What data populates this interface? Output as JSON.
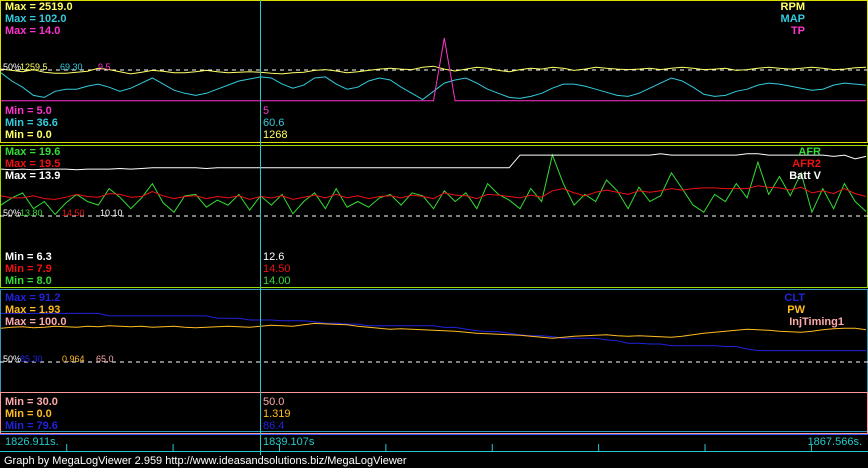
{
  "app": {
    "footer": "Graph by MegaLogViewer 2.959 http://www.ideasandsolutions.biz/MegaLogViewer"
  },
  "colors": {
    "rpm": "#FFFF66",
    "map": "#33CCDD",
    "tp": "#FF33CC",
    "afr": "#33DD33",
    "afr2": "#EE1111",
    "batt": "#FFFFFF",
    "clt": "#2222DD",
    "pw": "#FFBB22",
    "injtiming": "#FFAAAA",
    "cursor": "#22CCCC",
    "panel1_border": "#DDDD00",
    "panel2_border": "#99DD00",
    "panel3_border": "#3399BB",
    "panel4_border": "#FF9999"
  },
  "timeline": {
    "start": "1826.911s.",
    "cursor": "1839.107s",
    "end": "1867.566s."
  },
  "chart_data": [
    {
      "type": "line",
      "panel": "panel1",
      "x_range": [
        1826.911,
        1867.566
      ],
      "cursor_x": 1839.107,
      "series": [
        {
          "name": "RPM",
          "color_key": "rpm",
          "max_label": "Max = 2519.0",
          "min_label": "Min = 0.0",
          "cursor_value": "1268",
          "mid_value": "1259.5",
          "ylim": [
            0,
            2519
          ],
          "values": [
            1350,
            1300,
            1250,
            1330,
            1230,
            1190,
            1190,
            1230,
            1270,
            1380,
            1330,
            1250,
            1170,
            1230,
            1300,
            1270,
            1210,
            1210,
            1250,
            1300,
            1250,
            1210,
            1230,
            1250,
            1230,
            1190,
            1170,
            1210,
            1230,
            1300,
            1330,
            1280,
            1210,
            1250,
            1300,
            1350,
            1380,
            1350,
            1330,
            1420,
            1460,
            1350,
            1280,
            1350,
            1420,
            1380,
            1300,
            1250,
            1330,
            1380,
            1350,
            1420,
            1380,
            1300,
            1350,
            1420,
            1380,
            1350,
            1330,
            1350,
            1380,
            1330,
            1380,
            1420,
            1380,
            1330,
            1350,
            1380,
            1300,
            1330,
            1380,
            1420,
            1380,
            1350,
            1380,
            1420,
            1380,
            1330,
            1350,
            1400,
            1420
          ]
        },
        {
          "name": "MAP",
          "color_key": "map",
          "max_label": "Max = 102.0",
          "min_label": "Min = 36.6",
          "cursor_value": "60.6",
          "mid_value": "69.30",
          "ylim": [
            36.6,
            102.0
          ],
          "values": [
            68,
            60,
            54,
            46,
            44,
            50,
            52,
            52,
            55,
            57,
            54,
            50,
            53,
            58,
            63,
            57,
            51,
            48,
            46,
            48,
            52,
            56,
            60,
            62,
            64,
            63,
            57,
            53,
            56,
            63,
            64,
            57,
            52,
            54,
            60,
            63,
            61,
            54,
            48,
            42,
            50,
            58,
            61,
            63,
            58,
            52,
            48,
            44,
            43,
            45,
            48,
            53,
            57,
            57,
            55,
            52,
            49,
            46,
            45,
            48,
            53,
            58,
            63,
            60,
            54,
            47,
            45,
            46,
            50,
            52,
            56,
            58,
            57,
            55,
            53,
            51,
            52,
            56,
            58,
            57,
            56
          ]
        },
        {
          "name": "TP",
          "color_key": "tp",
          "max_label": "Max = 14.0",
          "min_label": "Min = 5.0",
          "cursor_value": "5",
          "mid_value": "9.5",
          "ylim": [
            4.4,
            14
          ],
          "values": [
            5,
            5,
            5,
            5,
            5,
            5,
            5,
            5,
            5,
            5,
            5,
            5,
            5,
            5,
            5,
            5,
            5,
            5,
            5,
            5,
            5,
            5,
            5,
            5,
            5,
            5,
            5,
            5,
            5,
            5,
            5,
            5,
            5,
            5,
            5,
            5,
            5,
            5,
            5,
            5,
            5,
            14,
            5,
            5,
            5,
            5,
            5,
            5,
            5,
            5,
            5,
            5,
            5,
            5,
            5,
            5,
            5,
            5,
            5,
            5,
            5,
            5,
            5,
            5,
            5,
            5,
            5,
            5,
            5,
            5,
            5,
            5,
            5,
            5,
            5,
            5,
            5,
            5,
            5,
            5,
            5
          ]
        }
      ]
    },
    {
      "type": "line",
      "panel": "panel2",
      "x_range": [
        1826.911,
        1867.566
      ],
      "cursor_x": 1839.107,
      "series": [
        {
          "name": "AFR",
          "color_key": "afr",
          "max_label": "Max = 19.6",
          "min_label": "Min = 8.0",
          "cursor_value": "14.00",
          "mid_value": "13.80",
          "ylim": [
            6.5,
            20.2
          ],
          "values": [
            12.5,
            13.5,
            14.2,
            12.0,
            13.0,
            11.2,
            12.8,
            14.0,
            13.0,
            12.5,
            14.8,
            13.6,
            12.0,
            13.5,
            15.5,
            12.8,
            11.5,
            13.8,
            14.0,
            12.2,
            13.2,
            12.5,
            14.0,
            11.8,
            13.8,
            12.5,
            14.0,
            11.3,
            13.0,
            14.2,
            12.0,
            14.8,
            12.2,
            13.0,
            12.2,
            13.5,
            14.0,
            12.5,
            14.2,
            13.8,
            12.0,
            14.5,
            13.0,
            14.2,
            12.0,
            15.5,
            14.0,
            13.2,
            12.0,
            14.8,
            13.0,
            19.5,
            15.5,
            12.5,
            14.0,
            13.0,
            16.0,
            14.5,
            12.0,
            15.0,
            13.0,
            13.8,
            17.0,
            14.8,
            12.5,
            11.5,
            14.0,
            13.0,
            15.5,
            13.5,
            18.5,
            14.0,
            16.5,
            13.8,
            17.0,
            11.5,
            14.8,
            12.0,
            15.5,
            13.0,
            11.6
          ]
        },
        {
          "name": "AFR2",
          "color_key": "afr2",
          "max_label": "Max = 19.5",
          "min_label": "Min = 7.9",
          "cursor_value": "14.50",
          "mid_value": "14.50",
          "ylim": [
            6.5,
            20.2
          ],
          "values": [
            13.8,
            13.5,
            13.5,
            13.8,
            13.4,
            13.3,
            13.6,
            14.0,
            13.7,
            13.6,
            14.1,
            14.0,
            13.6,
            13.7,
            14.4,
            13.8,
            13.4,
            13.7,
            13.8,
            13.4,
            13.7,
            13.5,
            13.8,
            13.3,
            13.7,
            13.5,
            13.8,
            13.3,
            13.6,
            13.9,
            13.5,
            14.0,
            13.5,
            13.8,
            13.4,
            13.7,
            13.8,
            13.5,
            13.9,
            13.7,
            13.4,
            14.2,
            13.9,
            13.8,
            13.4,
            14.0,
            13.9,
            13.7,
            13.5,
            13.9,
            13.6,
            14.5,
            14.8,
            14.2,
            13.8,
            14.3,
            14.6,
            14.3,
            14.0,
            14.5,
            14.3,
            14.5,
            14.8,
            14.6,
            14.8,
            14.9,
            14.9,
            14.8,
            14.8,
            14.8,
            15.2,
            15.0,
            14.9,
            14.6,
            15.0,
            14.2,
            14.5,
            14.1,
            14.8,
            14.1,
            13.7
          ]
        },
        {
          "name": "Batt V",
          "color_key": "batt",
          "max_label": "Max = 13.9",
          "min_label": "Min = 6.3",
          "cursor_value": "12.6",
          "mid_value": "10.10",
          "ylim": [
            6.3,
            14.0
          ],
          "values": [
            12.5,
            12.45,
            12.5,
            12.45,
            12.5,
            12.5,
            12.5,
            12.45,
            12.5,
            12.5,
            12.5,
            12.55,
            12.5,
            12.55,
            12.6,
            12.6,
            12.6,
            12.6,
            12.6,
            12.55,
            12.6,
            12.6,
            12.6,
            12.6,
            12.6,
            12.6,
            12.6,
            12.6,
            12.6,
            12.6,
            12.6,
            12.6,
            12.6,
            12.6,
            12.6,
            12.6,
            12.6,
            12.6,
            12.6,
            12.6,
            12.6,
            12.6,
            12.6,
            12.6,
            12.6,
            12.6,
            12.6,
            12.6,
            13.6,
            13.6,
            13.6,
            13.6,
            13.6,
            13.6,
            13.6,
            13.6,
            13.6,
            13.6,
            13.6,
            13.6,
            13.6,
            13.7,
            13.6,
            13.6,
            13.6,
            13.6,
            13.6,
            13.6,
            13.6,
            13.7,
            13.7,
            13.6,
            13.6,
            13.6,
            13.6,
            13.6,
            13.6,
            13.5,
            13.6,
            13.3,
            13.5
          ]
        }
      ]
    },
    {
      "type": "line",
      "panel": "panel3",
      "x_range": [
        1826.911,
        1867.566
      ],
      "cursor_x": 1839.107,
      "series": [
        {
          "name": "CLT",
          "color_key": "clt",
          "max_label": "Max = 91.2",
          "min_label": "Min = 79.6",
          "cursor_value": "86.4",
          "mid_value": "85.30",
          "ylim": [
            79.6,
            91.2
          ],
          "values": [
            89.1,
            89.1,
            89.1,
            89.1,
            89.1,
            89.1,
            89.1,
            89.1,
            89.1,
            89.1,
            88.8,
            88.8,
            88.8,
            88.8,
            88.8,
            88.8,
            88.8,
            88.8,
            88.8,
            88.8,
            88.5,
            88.5,
            88.5,
            88.3,
            88.3,
            88.3,
            88.2,
            88.2,
            88.2,
            88.1,
            87.9,
            87.9,
            87.8,
            87.8,
            87.6,
            87.6,
            87.6,
            87.6,
            87.6,
            87.6,
            87.6,
            87.4,
            87.4,
            87.2,
            87.0,
            86.9,
            86.9,
            86.7,
            86.5,
            86.4,
            86.4,
            86.3,
            86.1,
            86.1,
            86.1,
            86.1,
            85.9,
            85.8,
            85.5,
            85.5,
            85.4,
            85.4,
            85.2,
            85.2,
            85.2,
            85.2,
            85.2,
            85.1,
            85.1,
            84.8,
            84.6,
            84.6,
            84.6,
            84.6,
            84.6,
            84.6,
            84.6,
            84.6,
            84.6,
            84.6,
            84.6
          ]
        },
        {
          "name": "PW",
          "color_key": "pw",
          "max_label": "Max = 1.93",
          "min_label": "Min = 0.0",
          "cursor_value": "1.319",
          "mid_value": "0.964",
          "ylim": [
            0,
            1.93
          ],
          "values": [
            1.28,
            1.3,
            1.31,
            1.29,
            1.3,
            1.32,
            1.31,
            1.3,
            1.32,
            1.31,
            1.33,
            1.32,
            1.31,
            1.32,
            1.3,
            1.31,
            1.32,
            1.3,
            1.29,
            1.3,
            1.31,
            1.32,
            1.31,
            1.3,
            1.32,
            1.34,
            1.33,
            1.32,
            1.35,
            1.38,
            1.37,
            1.36,
            1.35,
            1.32,
            1.3,
            1.28,
            1.26,
            1.27,
            1.26,
            1.25,
            1.24,
            1.23,
            1.22,
            1.2,
            1.18,
            1.17,
            1.16,
            1.15,
            1.14,
            1.12,
            1.1,
            1.08,
            1.1,
            1.12,
            1.13,
            1.14,
            1.15,
            1.13,
            1.12,
            1.13,
            1.12,
            1.11,
            1.1,
            1.12,
            1.15,
            1.18,
            1.2,
            1.22,
            1.24,
            1.26,
            1.25,
            1.24,
            1.22,
            1.21,
            1.2,
            1.22,
            1.25,
            1.27,
            1.28,
            1.28,
            1.25
          ]
        },
        {
          "name": "InjTiming1",
          "color_key": "injtiming",
          "max_label": "Max = 100.0",
          "min_label": "Min = 30.0",
          "cursor_value": "50.0",
          "mid_value": "65.0",
          "ylim": [
            30,
            100
          ],
          "values": []
        }
      ]
    }
  ]
}
